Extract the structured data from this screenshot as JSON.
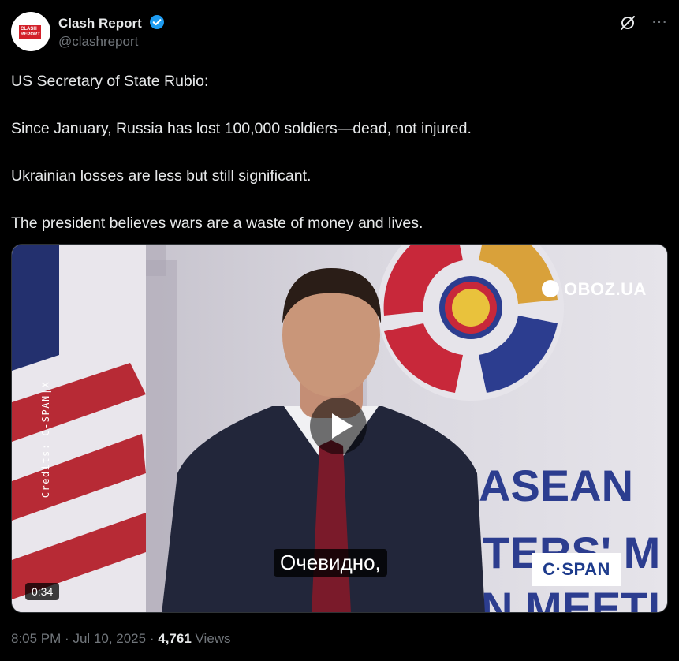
{
  "account": {
    "name": "Clash Report",
    "handle": "@clashreport",
    "logo_text": "CLASH REPORT"
  },
  "post": {
    "lines": [
      "US Secretary of State Rubio:",
      "Since January, Russia has lost 100,000 soldiers—dead, not injured.",
      "Ukrainian losses are less but still significant.",
      "The president believes wars are a waste of money and lives."
    ]
  },
  "video": {
    "duration": "0:34",
    "watermark": "OBOZ.UA",
    "credits": "Credits: C-SPAN|X",
    "subtitle": "Очевидно,",
    "network_logo": "C·SPAN",
    "backdrop_text_1": "ASEAN",
    "backdrop_text_2": "STERS' M",
    "backdrop_text_3": "N MEETI"
  },
  "footer": {
    "time": "8:05 PM",
    "date": "Jul 10, 2025",
    "views_count": "4,761",
    "views_label": "Views",
    "separator": "·"
  },
  "colors": {
    "verified": "#1d9bf0",
    "text": "#e7e9ea",
    "muted": "#71767b"
  },
  "icons": [
    "verified-badge-icon",
    "grok-icon",
    "more-icon",
    "play-icon"
  ]
}
